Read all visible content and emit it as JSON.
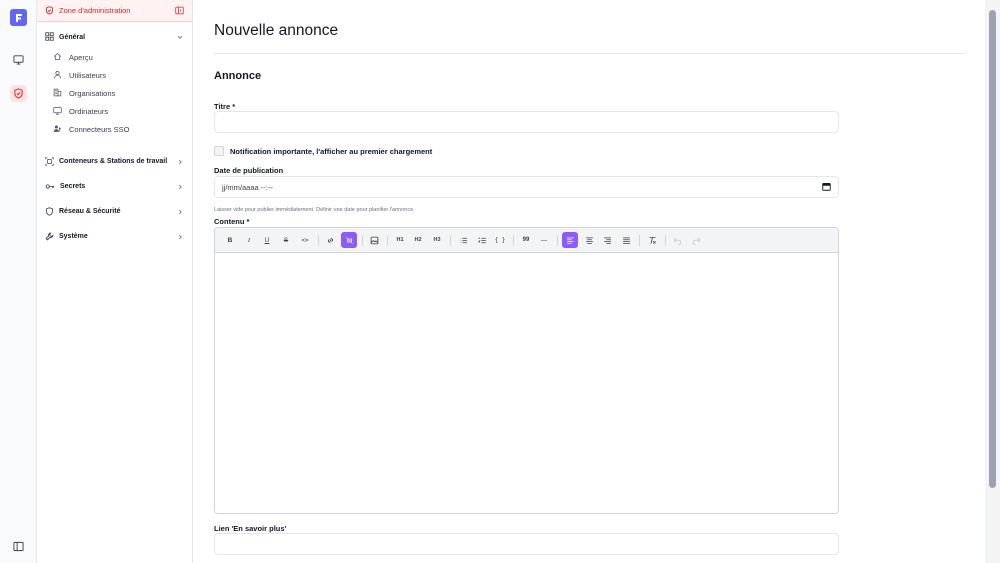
{
  "colors": {
    "accent": "#8b5cf6",
    "admin": "#dc2626",
    "logo": "#6366f1"
  },
  "rail": {
    "icons": [
      "logo-icon",
      "monitor-icon",
      "shield-icon",
      "sidebar-toggle-icon"
    ]
  },
  "sidebar": {
    "header": "Zone d'administration",
    "general": {
      "label": "Général",
      "items": [
        {
          "label": "Aperçu",
          "icon": "home-icon"
        },
        {
          "label": "Utilisateurs",
          "icon": "user-icon"
        },
        {
          "label": "Organisations",
          "icon": "building-icon"
        },
        {
          "label": "Ordinateurs",
          "icon": "monitor-icon"
        },
        {
          "label": "Connecteurs SSO",
          "icon": "users-key-icon"
        }
      ]
    },
    "sections": [
      {
        "label": "Conteneurs & Stations de travail",
        "icon": "container-icon"
      },
      {
        "label": "Secrets",
        "icon": "key-icon"
      },
      {
        "label": "Réseau & Sécurité",
        "icon": "shield-icon"
      },
      {
        "label": "Système",
        "icon": "wrench-icon"
      }
    ]
  },
  "main": {
    "title": "Nouvelle annonce",
    "section": "Annonce",
    "titre_label": "Titre *",
    "titre_value": "",
    "checkbox_label": "Notification importante, l'afficher au premier chargement",
    "date_label": "Date de publication",
    "date_placeholder": "jj/mm/aaaa --:--",
    "date_hint": "Laisser vide pour publier immédiatement. Définir une date pour planifier l'annonce.",
    "content_label": "Contenu *",
    "toolbar": {
      "bold": "B",
      "italic": "I",
      "underline": "U",
      "strike": "S",
      "code": "<>",
      "h1": "H1",
      "h2": "H2",
      "h3": "H3",
      "code_block": "{ }",
      "quote": "99",
      "hr": "—"
    },
    "link_label": "Lien 'En savoir plus'"
  }
}
